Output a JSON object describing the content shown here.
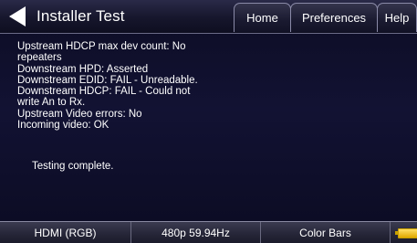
{
  "header": {
    "title": "Installer Test",
    "tabs": [
      {
        "label": "Home"
      },
      {
        "label": "Preferences"
      },
      {
        "label": "Help"
      }
    ]
  },
  "results": {
    "lines": [
      "Upstream HDCP max dev count: No",
      "repeaters",
      "Downstream HPD: Asserted",
      "Downstream EDID: FAIL - Unreadable.",
      "Downstream HDCP: FAIL - Could not",
      "write An to Rx.",
      "Upstream Video errors: No",
      "Incoming video: OK"
    ],
    "status": "Testing complete."
  },
  "status_bar": {
    "output": "HDMI (RGB)",
    "resolution": "480p 59.94Hz",
    "pattern": "Color Bars",
    "battery_icon": "battery-icon"
  },
  "colors": {
    "background": "#121233",
    "text": "#ffffff",
    "battery": "#f0c000"
  }
}
